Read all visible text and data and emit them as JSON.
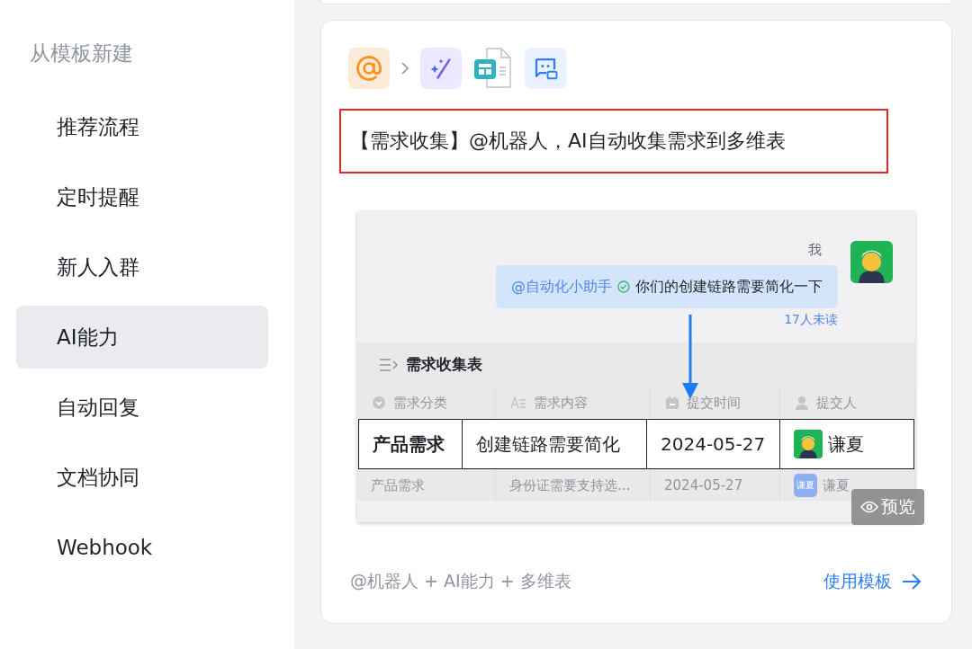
{
  "sidebar": {
    "heading": "从模板新建",
    "items": [
      {
        "label": "推荐流程",
        "selected": false
      },
      {
        "label": "定时提醒",
        "selected": false
      },
      {
        "label": "新人入群",
        "selected": false
      },
      {
        "label": "AI能力",
        "selected": true
      },
      {
        "label": "自动回复",
        "selected": false
      },
      {
        "label": "文档协同",
        "selected": false
      },
      {
        "label": "Webhook",
        "selected": false
      }
    ]
  },
  "card": {
    "steps": [
      {
        "kind": "mention"
      },
      {
        "kind": "ai"
      },
      {
        "kind": "sheet"
      },
      {
        "kind": "bot"
      }
    ],
    "title": "【需求收集】@机器人，AI自动收集需求到多维表",
    "title_highlighted": true,
    "preview": {
      "sender": "我",
      "mention": "@自动化小助手",
      "message": "你们的创建链路需要简化一下",
      "unread": "17人未读",
      "table_title": "需求收集表",
      "columns": [
        {
          "label": "需求分类",
          "kind": "select"
        },
        {
          "label": "需求内容",
          "kind": "text"
        },
        {
          "label": "提交时间",
          "kind": "date"
        },
        {
          "label": "提交人",
          "kind": "person"
        }
      ],
      "rows": [
        {
          "highlighted": true,
          "cells": [
            "产品需求",
            "创建链路需要简化",
            "2024-05-27",
            "谦夏"
          ]
        },
        {
          "highlighted": false,
          "cells": [
            "产品需求",
            "身份证需要支持选...",
            "2024-05-27",
            "谦夏"
          ],
          "avatar": {
            "kind": "initials",
            "label": "谦夏"
          }
        }
      ],
      "preview_button": "预览"
    },
    "tags": "@机器人 + AI能力 + 多维表",
    "action": "使用模板"
  }
}
